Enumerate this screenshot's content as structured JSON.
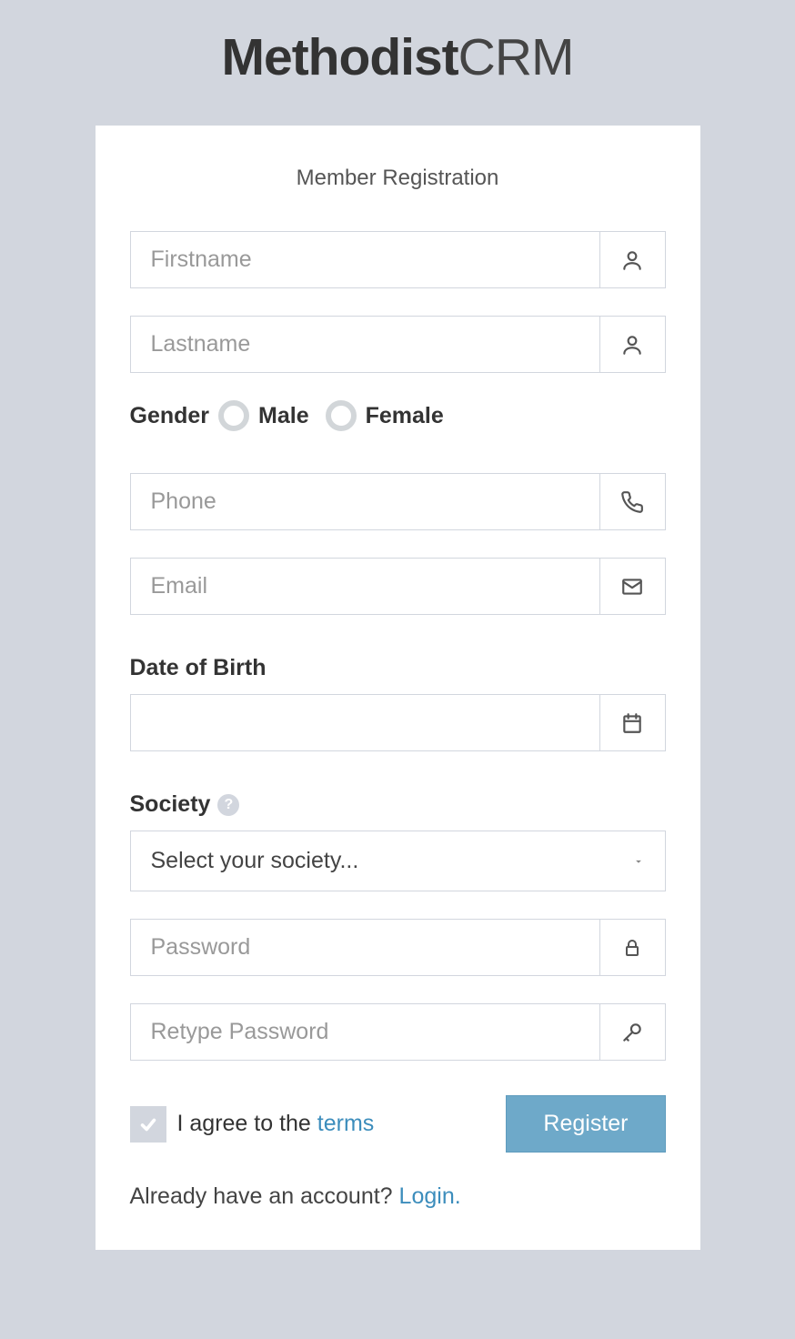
{
  "logo": {
    "bold": "Methodist",
    "thin": "CRM"
  },
  "card": {
    "title": "Member Registration",
    "firstname_placeholder": "Firstname",
    "lastname_placeholder": "Lastname",
    "gender_label": "Gender",
    "male_label": "Male",
    "female_label": "Female",
    "phone_placeholder": "Phone",
    "email_placeholder": "Email",
    "dob_label": "Date of Birth",
    "society_label": "Society",
    "society_placeholder": "Select your society...",
    "password_placeholder": "Password",
    "retype_placeholder": "Retype Password",
    "agree_text": "I agree to the ",
    "terms_text": "terms",
    "register_label": "Register",
    "existing_text": "Already have an account? ",
    "login_text": "Login."
  }
}
